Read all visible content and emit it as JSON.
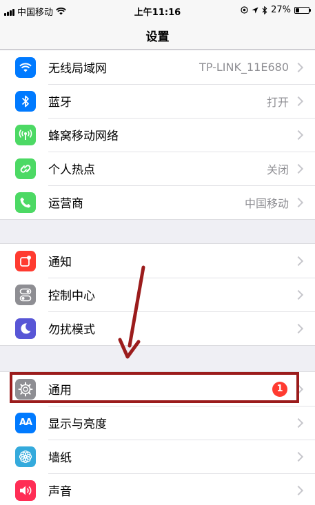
{
  "status_bar": {
    "carrier": "中国移动",
    "time": "上午11:16",
    "battery_percent": "27%",
    "battery_level": 0.27,
    "icons": [
      "signal-icon",
      "wifi-icon",
      "location-icon",
      "bluetooth-icon",
      "battery-icon"
    ]
  },
  "nav": {
    "title": "设置"
  },
  "groups": [
    {
      "items": [
        {
          "label": "无线局域网",
          "value": "TP-LINK_11E680",
          "icon": "wifi-icon",
          "color": "#007aff"
        },
        {
          "label": "蓝牙",
          "value": "打开",
          "icon": "bluetooth-icon",
          "color": "#007aff"
        },
        {
          "label": "蜂窝移动网络",
          "value": "",
          "icon": "cellular-icon",
          "color": "#4cd964"
        },
        {
          "label": "个人热点",
          "value": "关闭",
          "icon": "hotspot-icon",
          "color": "#4cd964"
        },
        {
          "label": "运营商",
          "value": "中国移动",
          "icon": "phone-icon",
          "color": "#4cd964"
        }
      ]
    },
    {
      "items": [
        {
          "label": "通知",
          "value": "",
          "icon": "notification-icon",
          "color": "#ff3b30"
        },
        {
          "label": "控制中心",
          "value": "",
          "icon": "control-center-icon",
          "color": "#8e8e93"
        },
        {
          "label": "勿扰模式",
          "value": "",
          "icon": "moon-icon",
          "color": "#5856d6"
        }
      ]
    },
    {
      "items": [
        {
          "label": "通用",
          "value": "",
          "badge": "1",
          "icon": "gear-icon",
          "color": "#8e8e93"
        },
        {
          "label": "显示与亮度",
          "value": "",
          "icon": "display-icon",
          "color": "#007aff",
          "icon_text": "AA"
        },
        {
          "label": "墙纸",
          "value": "",
          "icon": "wallpaper-icon",
          "color": "#34aadc"
        },
        {
          "label": "声音",
          "value": "",
          "icon": "sound-icon",
          "color": "#ff2d55"
        }
      ]
    }
  ],
  "annotation": {
    "color": "#9b1c1c"
  }
}
